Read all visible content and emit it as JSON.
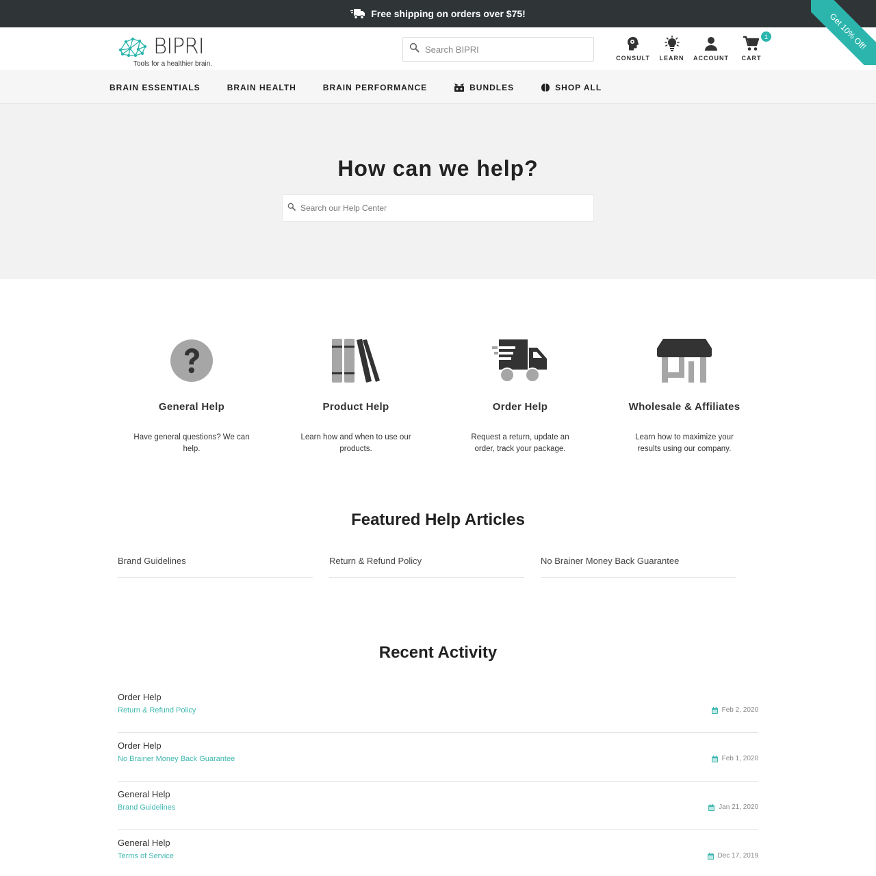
{
  "colors": {
    "accent": "#2bb5ad",
    "dark": "#2f3537",
    "icon_grey": "#a6a6a6",
    "icon_dark": "#333333"
  },
  "promo": {
    "text": "Free shipping on orders over $75!",
    "icon": "truck-icon",
    "ribbon": "Get 10% Off!"
  },
  "header": {
    "logo_word": "BIPRI",
    "logo_tagline": "Tools for a healthier brain.",
    "search_placeholder": "Search BIPRI",
    "icons": [
      {
        "label": "CONSULT",
        "icon": "head-icon"
      },
      {
        "label": "LEARN",
        "icon": "lightbulb-icon"
      },
      {
        "label": "ACCOUNT",
        "icon": "user-icon"
      },
      {
        "label": "CART",
        "icon": "cart-icon",
        "count": "1"
      }
    ]
  },
  "nav": {
    "items": [
      {
        "label": "BRAIN ESSENTIALS"
      },
      {
        "label": "BRAIN HEALTH"
      },
      {
        "label": "BRAIN PERFORMANCE"
      },
      {
        "label": "BUNDLES",
        "icon": "bundles-icon"
      },
      {
        "label": "SHOP ALL",
        "icon": "brain-icon"
      }
    ]
  },
  "hero": {
    "title": "How can we help?",
    "search_placeholder": "Search our Help Center"
  },
  "categories": [
    {
      "title": "General Help",
      "desc": "Have general questions? We can help.",
      "icon": "question-icon"
    },
    {
      "title": "Product Help",
      "desc": "Learn how and when to use our products.",
      "icon": "books-icon"
    },
    {
      "title": "Order Help",
      "desc": "Request a return, update an order, track your package.",
      "icon": "delivery-truck-icon"
    },
    {
      "title": "Wholesale & Affiliates",
      "desc": "Learn how to maximize your results using our company.",
      "icon": "store-icon"
    }
  ],
  "featured": {
    "title": "Featured Help Articles",
    "items": [
      "Brand Guidelines",
      "Return & Refund Policy",
      "No Brainer Money Back Guarantee"
    ]
  },
  "recent": {
    "title": "Recent Activity",
    "items": [
      {
        "category": "Order Help",
        "article": "Return & Refund Policy",
        "date": "Feb 2, 2020"
      },
      {
        "category": "Order Help",
        "article": "No Brainer Money Back Guarantee",
        "date": "Feb 1, 2020"
      },
      {
        "category": "General Help",
        "article": "Brand Guidelines",
        "date": "Jan 21, 2020"
      },
      {
        "category": "General Help",
        "article": "Terms of Service",
        "date": "Dec 17, 2019"
      }
    ]
  }
}
